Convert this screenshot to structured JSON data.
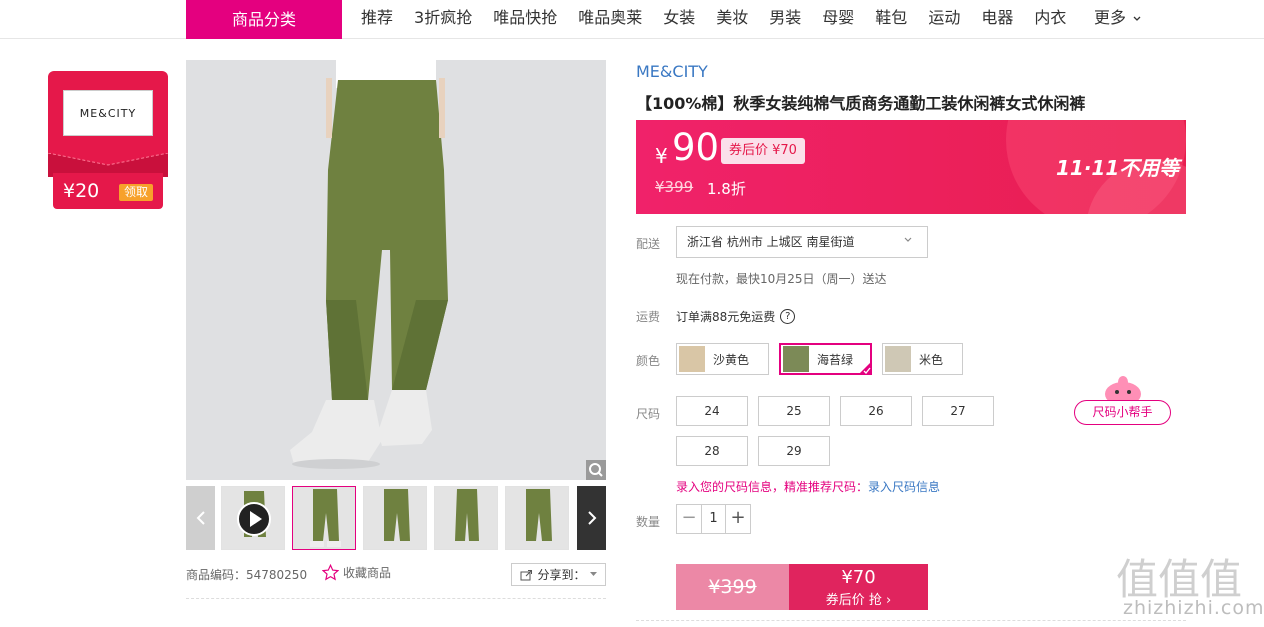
{
  "nav": {
    "category_label": "商品分类",
    "items": [
      "推荐",
      "3折疯抢",
      "唯品快抢",
      "唯品奥莱",
      "女装",
      "美妆",
      "男装",
      "母婴",
      "鞋包",
      "运动",
      "电器",
      "内衣"
    ],
    "more_label": "更多"
  },
  "coupon": {
    "logo_text": "ME&CITY",
    "amount": "¥20",
    "get_label": "领取"
  },
  "gallery": {
    "product_code": "商品编码：54780250",
    "favorite_label": "收藏商品",
    "share_label": "分享到："
  },
  "product": {
    "brand": "ME&CITY",
    "title": "【100%棉】秋季女装纯棉气质商务通勤工装休闲裤女式休闲裤",
    "currency": "¥",
    "price": "90",
    "after_coupon": "券后价 ¥70",
    "original_price": "¥399",
    "discount": "1.8折",
    "promo_text": "11·11不用等"
  },
  "delivery": {
    "label": "配送",
    "address": "浙江省 杭州市 上城区 南星街道",
    "ship_time": "现在付款，最快10月25日（周一）送达"
  },
  "freight": {
    "label": "运费",
    "text": "订单满88元免运费",
    "help_symbol": "?"
  },
  "colors": {
    "label": "颜色",
    "options": [
      "沙黄色",
      "海苔绿",
      "米色"
    ],
    "selected": "海苔绿"
  },
  "sizes": {
    "label": "尺码",
    "options": [
      "24",
      "25",
      "26",
      "27",
      "28",
      "29"
    ],
    "helper_label": "尺码小帮手",
    "note_prefix": "录入您的尺码信息，精准推荐尺码：",
    "note_link": "录入尺码信息"
  },
  "quantity": {
    "label": "数量",
    "value": "1",
    "minus": "−",
    "plus": "+"
  },
  "buy": {
    "original_price": "¥399",
    "coupon_price": "¥70",
    "coupon_action": "券后价 抢 ›"
  },
  "watermark": {
    "logo": "值值值",
    "text": "zhizhizhi.com"
  },
  "colors_theme": {
    "accent": "#e4007f",
    "price_red": "#e5184a",
    "link_blue": "#3a78c3"
  }
}
